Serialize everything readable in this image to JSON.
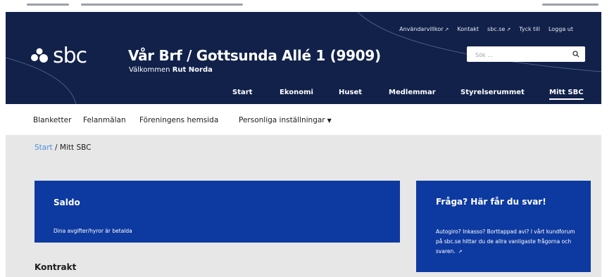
{
  "colors": {
    "header_bg": "#11214a",
    "card_blue": "#0d3aa0",
    "content_bg": "#e7e7e7",
    "link_blue": "#4a8fd6"
  },
  "header": {
    "logo_text": "sbc",
    "title": "Vår Brf / Gottsunda Allé 1 (9909)",
    "welcome_prefix": "Välkommen",
    "welcome_name": "Rut Norda",
    "utility_links": [
      {
        "label": "Användarvillkor",
        "icon": "external-link-icon"
      },
      {
        "label": "Kontakt"
      },
      {
        "label": "sbc.se",
        "icon": "external-link-icon"
      },
      {
        "label": "Tyck till"
      },
      {
        "label": "Logga ut"
      }
    ],
    "search": {
      "placeholder": "Sök ...",
      "icon": "search-icon"
    }
  },
  "main_nav": [
    {
      "label": "Start"
    },
    {
      "label": "Ekonomi"
    },
    {
      "label": "Huset"
    },
    {
      "label": "Medlemmar"
    },
    {
      "label": "Styrelserummet"
    },
    {
      "label": "Mitt SBC",
      "active": true
    }
  ],
  "sub_nav": [
    {
      "label": "Blanketter"
    },
    {
      "label": "Felanmälan"
    },
    {
      "label": "Föreningens hemsida"
    },
    {
      "label": "Personliga inställningar",
      "icon": "caret-down-icon"
    }
  ],
  "breadcrumb": {
    "home": "Start",
    "separator": "/",
    "current": "Mitt SBC"
  },
  "saldo_card": {
    "title": "Saldo",
    "text": "Dina avgifter/hyror är betalda"
  },
  "faq_card": {
    "title": "Fråga? Här får du svar!",
    "text": "Autogiro? Inkasso? Borttappad avi? I vårt kundforum på sbc.se hittar du de allra vanligaste frågorna och svaren.",
    "icon": "external-link-icon"
  },
  "section_heading": "Kontrakt"
}
